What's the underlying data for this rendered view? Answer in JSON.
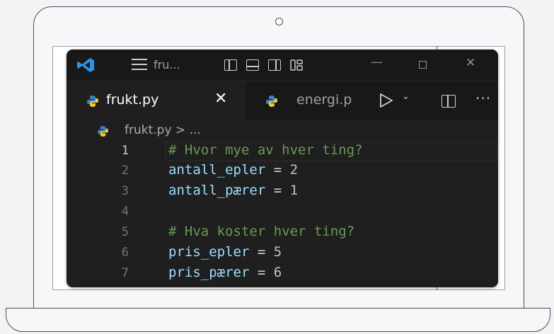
{
  "colors": {
    "comment": "#6a9955",
    "variable": "#9cdcfe",
    "operator": "#d4d4d4",
    "number": "#b5cea8",
    "python_blue": "#3f7fc0",
    "python_yellow": "#f0c93a",
    "vscode_blue": "#2b94e9"
  },
  "titlebar": {
    "title": "fru...",
    "minimize": "—",
    "close": "✕"
  },
  "tabs": [
    {
      "label": "frukt.py",
      "icon": "python-icon",
      "close": "✕"
    },
    {
      "label": "energi.p",
      "icon": "python-icon"
    }
  ],
  "toolbar": {
    "more": "···",
    "run_chevron": "⌄"
  },
  "breadcrumb": {
    "text": "frukt.py > ..."
  },
  "editor": {
    "lines": [
      {
        "number": "1",
        "comment": "# Hvor mye av hver ting?"
      },
      {
        "number": "2",
        "var": "antall_epler",
        "op": " = ",
        "num": "2"
      },
      {
        "number": "3",
        "var": "antall_pærer",
        "op": " = ",
        "num": "1"
      },
      {
        "number": "4"
      },
      {
        "number": "5",
        "comment": "# Hva koster hver ting?"
      },
      {
        "number": "6",
        "var": "pris_epler",
        "op": " = ",
        "num": "5"
      },
      {
        "number": "7",
        "var": "pris_pærer",
        "op": " = ",
        "num": "6"
      }
    ]
  }
}
